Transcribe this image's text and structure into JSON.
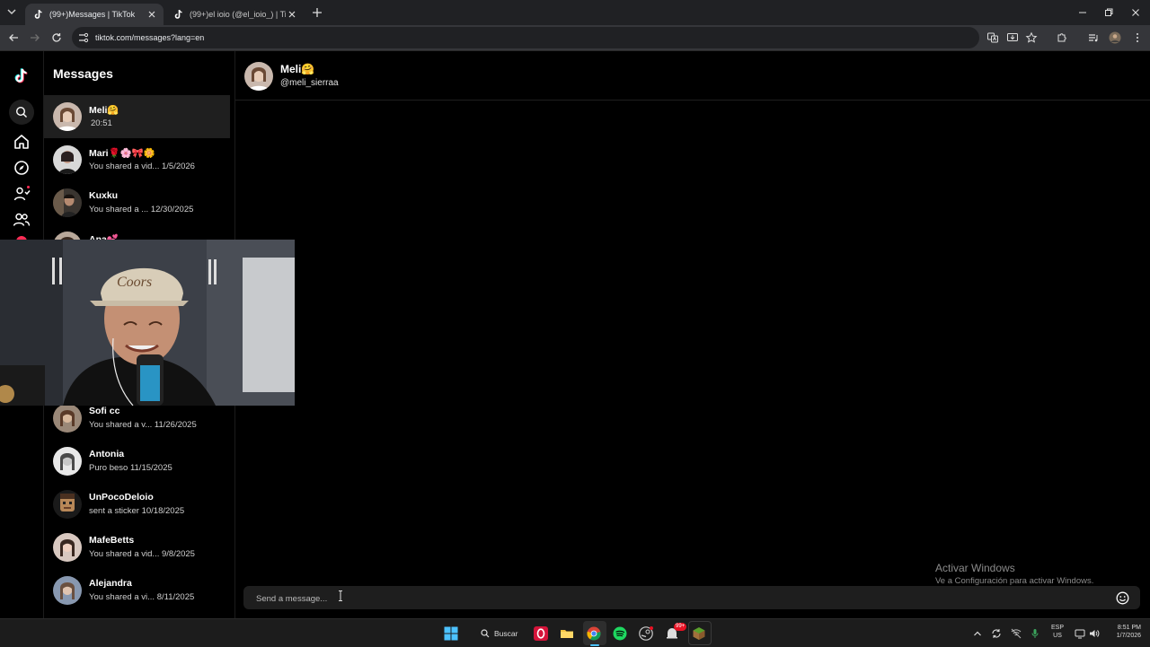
{
  "browser": {
    "tabs": [
      {
        "title": "(99+)Messages | TikTok",
        "active": true
      },
      {
        "title": "(99+)el ioio (@el_ioio_) | TikTok",
        "active": false
      }
    ],
    "url": "tiktok.com/messages?lang=en"
  },
  "tiktok": {
    "messages_title": "Messages",
    "conversations": [
      {
        "name": "Meli🤗",
        "preview": "20:51",
        "selected": true
      },
      {
        "name": "Mari🌹🌸🎀🌼",
        "preview": "You shared a vid... 1/5/2026"
      },
      {
        "name": "Kuxku",
        "preview": "You shared a ... 12/30/2025"
      },
      {
        "name": "Ana💕",
        "preview": ""
      },
      {
        "name": "Sofi cc",
        "preview": "You shared a v... 11/26/2025"
      },
      {
        "name": "Antonia",
        "preview": "Puro beso 11/15/2025"
      },
      {
        "name": "UnPocoDeloio",
        "preview": "sent a sticker 10/18/2025"
      },
      {
        "name": "MafeBetts",
        "preview": "You shared a vid... 9/8/2025"
      },
      {
        "name": "Alejandra",
        "preview": "You shared a vi... 8/11/2025"
      }
    ],
    "chat": {
      "name": "Meli🤗",
      "handle": "@meli_sierraa",
      "input_placeholder": "Send a message..."
    }
  },
  "windows_watermark": {
    "line1": "Activar Windows",
    "line2": "Ve a Configuración para activar Windows."
  },
  "taskbar": {
    "search_label": "Buscar",
    "notification_badge": "99+",
    "lang_line1": "ESP",
    "lang_line2": "US",
    "time": "8:51 PM",
    "date": "1/7/2026"
  },
  "colors": {
    "tiktok_red": "#fe2c55",
    "tiktok_cyan": "#25f4ee",
    "chrome_dark": "#202124",
    "chrome_toolbar": "#35363a"
  }
}
